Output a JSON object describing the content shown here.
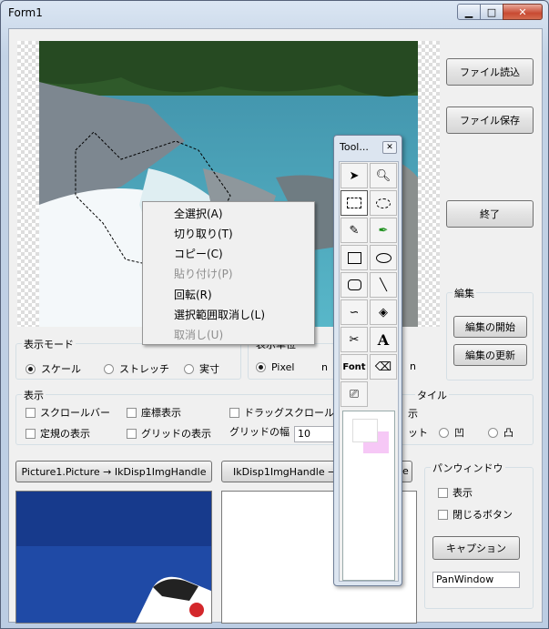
{
  "window": {
    "title": "Form1"
  },
  "buttons": {
    "load": "ファイル読込",
    "save": "ファイル保存",
    "exit": "終了",
    "edit_start": "編集の開始",
    "edit_update": "編集の更新",
    "pic_to_handle": "Picture1.Picture → IkDisp1ImgHandle",
    "handle_to_pic": "IkDisp1ImgHandle →",
    "caption": "キャプション"
  },
  "display_mode": {
    "label": "表示モード",
    "options": [
      "スケール",
      "ストレッチ",
      "実寸"
    ],
    "selected": "スケール"
  },
  "display_pos": {
    "label": "表示単位",
    "options": [
      "Pixel"
    ]
  },
  "display": {
    "label": "表示",
    "scrollbar": "スクロールバー",
    "coords": "座標表示",
    "drag_scroll": "ドラッグスクロール",
    "ruler": "定規の表示",
    "grid": "グリッドの表示",
    "grid_width_label": "グリッドの幅",
    "grid_width_value": "10"
  },
  "edit": {
    "label": "編集"
  },
  "style": {
    "label": "タイル"
  },
  "pan": {
    "label": "パンウィンドウ",
    "show": "表示",
    "close_btn": "閉じるボタン",
    "caption_value": "PanWindow"
  },
  "context_menu": [
    {
      "label": "全選択(A)",
      "enabled": true
    },
    {
      "label": "切り取り(T)",
      "enabled": true
    },
    {
      "label": "コピー(C)",
      "enabled": true
    },
    {
      "label": "貼り付け(P)",
      "enabled": false
    },
    {
      "label": "回転(R)",
      "enabled": true
    },
    {
      "label": "選択範囲取消し(L)",
      "enabled": true
    },
    {
      "label": "取消し(U)",
      "enabled": false
    }
  ],
  "toolbox": {
    "title": "Tool...",
    "font_label": "Font",
    "text_label": "A"
  },
  "partial": {
    "style_right1": "ット",
    "display_right": "示",
    "right_n": "n",
    "right_e": "e"
  }
}
